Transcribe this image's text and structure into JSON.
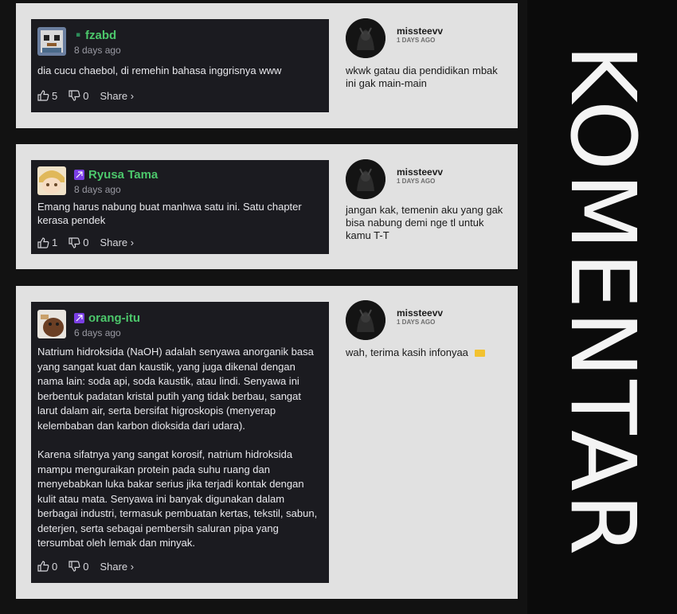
{
  "sidebar": {
    "title": "KOMENTAR"
  },
  "threads": [
    {
      "comment": {
        "username": "fzabd",
        "time": "8 days ago",
        "paragraphs": [
          "dia cucu chaebol, di remehin bahasa inggrisnya www"
        ],
        "likes": "5",
        "dislikes": "0",
        "share_label": "Share ›"
      },
      "reply": {
        "username": "missteevv",
        "time": "1 DAYS AGO",
        "text": "wkwk gatau dia pendidikan mbak ini gak main-main"
      }
    },
    {
      "comment": {
        "username": "Ryusa Tama",
        "time": "8 days ago",
        "paragraphs": [
          "Emang harus nabung buat manhwa satu ini. Satu chapter kerasa pendek"
        ],
        "likes": "1",
        "dislikes": "0",
        "share_label": "Share ›"
      },
      "reply": {
        "username": "missteevv",
        "time": "1 DAYS AGO",
        "text": "jangan kak, temenin aku yang gak bisa nabung demi nge tl untuk kamu T-T"
      }
    },
    {
      "comment": {
        "username": "orang-itu",
        "time": "6 days ago",
        "paragraphs": [
          "Natrium hidroksida (NaOH) adalah senyawa anorganik basa yang sangat kuat dan kaustik, yang juga dikenal dengan nama lain: soda api, soda kaustik, atau lindi. Senyawa ini berbentuk padatan kristal putih yang tidak berbau, sangat larut dalam air, serta bersifat higroskopis (menyerap kelembaban dan karbon dioksida dari udara).",
          "Karena sifatnya yang sangat korosif, natrium hidroksida mampu menguraikan protein pada suhu ruang dan menyebabkan luka bakar serius jika terjadi kontak dengan kulit atau mata. Senyawa ini banyak digunakan dalam berbagai industri, termasuk pembuatan kertas, tekstil, sabun, deterjen, serta sebagai pembersih saluran pipa yang tersumbat oleh lemak dan minyak."
        ],
        "likes": "0",
        "dislikes": "0",
        "share_label": "Share ›"
      },
      "reply": {
        "username": "missteevv",
        "time": "1 DAYS AGO",
        "text": "wah, terima kasih infonyaa"
      }
    }
  ],
  "colors": {
    "page_bg": "#121212",
    "panel_bg": "#e1e1e1",
    "card_bg": "#1b1b20",
    "username": "#4cc76b",
    "badge": "#7b3fe4"
  }
}
